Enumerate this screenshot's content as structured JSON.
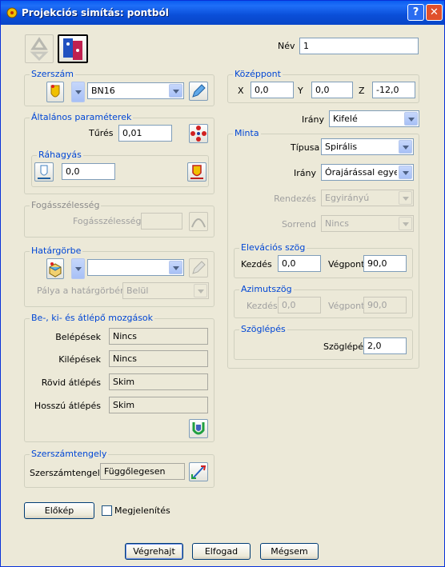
{
  "window": {
    "title": "Projekciós simítás: pontból",
    "help": "?",
    "close": "✕"
  },
  "top": {
    "nev_label": "Név",
    "nev_value": "1"
  },
  "szerszam": {
    "legend": "Szerszám",
    "tool_value": "BN16"
  },
  "altalanos": {
    "legend": "Általános paraméterek",
    "tures_label": "Tűrés",
    "tures_value": "0,01",
    "rahagyas_legend": "Ráhagyás",
    "rahagyas_value": "0,0"
  },
  "fogas": {
    "legend": "Fogásszélesség",
    "label": "Fogásszélesség",
    "value": ""
  },
  "hatargorbe": {
    "legend": "Határgörbe",
    "value": "",
    "palya_label": "Pálya a határgörbén",
    "palya_value": "Belül"
  },
  "mozgasok": {
    "legend": "Be-, ki- és átlépő mozgások",
    "rows": [
      {
        "label": "Belépések",
        "value": "Nincs"
      },
      {
        "label": "Kilépések",
        "value": "Nincs"
      },
      {
        "label": "Rövid átlépés",
        "value": "Skim"
      },
      {
        "label": "Hosszú átlépés",
        "value": "Skim"
      }
    ]
  },
  "tengely": {
    "legend": "Szerszámtengely",
    "label": "Szerszámtengely",
    "value": "Függőlegesen"
  },
  "bottom_left": {
    "preview": "Előkép",
    "show_label": "Megjelenítés"
  },
  "kozeppont": {
    "legend": "Középpont",
    "x_label": "X",
    "x": "0,0",
    "y_label": "Y",
    "y": "0,0",
    "z_label": "Z",
    "z": "-12,0"
  },
  "irany_top": {
    "label": "Irány",
    "value": "Kifelé"
  },
  "minta": {
    "legend": "Minta",
    "tipus_label": "Típusa",
    "tipus_value": "Spirális",
    "irany_label": "Irány",
    "irany_value": "Órajárással egyező",
    "rendezes_label": "Rendezés",
    "rendezes_value": "Egyirányú",
    "sorrend_label": "Sorrend",
    "sorrend_value": "Nincs"
  },
  "elevacio": {
    "legend": "Elevációs szög",
    "kezdes_label": "Kezdés",
    "kezdes": "0,0",
    "vegpont_label": "Végpont",
    "vegpont": "90,0"
  },
  "azimut": {
    "legend": "Azimutszög",
    "kezdes_label": "Kezdés",
    "kezdes": "0,0",
    "vegpont_label": "Végpont",
    "vegpont": "90,0"
  },
  "szoglepes": {
    "legend": "Szöglépés",
    "label": "Szöglépés",
    "value": "2,0"
  },
  "buttons": {
    "vegrehajt": "Végrehajt",
    "elfogad": "Elfogad",
    "megsem": "Mégsem"
  }
}
